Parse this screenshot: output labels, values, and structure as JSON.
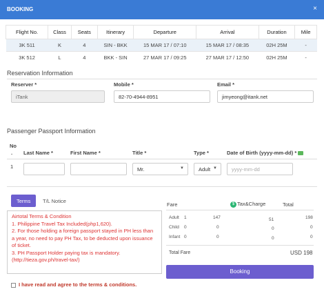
{
  "header": {
    "title": "BOOKING",
    "close_icon": "×"
  },
  "flights": {
    "columns": [
      "Flight No.",
      "Class",
      "Seats",
      "Itinerary",
      "Departure",
      "Arrival",
      "Duration",
      "Mile"
    ],
    "rows": [
      [
        "3K 511",
        "K",
        "4",
        "SIN - BKK",
        "15 MAR 17 / 07:10",
        "15 MAR 17 / 08:35",
        "02H 25M",
        "-"
      ],
      [
        "3K 512",
        "L",
        "4",
        "BKK - SIN",
        "27 MAR 17 / 09:25",
        "27 MAR 17 / 12:50",
        "02H 25M",
        "-"
      ]
    ]
  },
  "reservation": {
    "title": "Reservation Information",
    "reserver_label": "Reserver *",
    "reserver_value": "iTank",
    "mobile_label": "Mobile *",
    "mobile_value": "82-70-4944-8951",
    "email_label": "Email *",
    "email_value": "jimyeong@itank.net"
  },
  "passport": {
    "title": "Passenger Passport Information",
    "no_label_1": "No",
    "no_label_2": ".",
    "last_name_label": "Last Name *",
    "first_name_label": "First Name *",
    "title_label": "Title *",
    "type_label": "Type *",
    "dob_label": "Date of Birth (yyyy-mm-dd) *",
    "row_no": "1",
    "title_value": "Mr.",
    "type_value": "Adult",
    "dob_placeholder": "yyyy-mm-dd"
  },
  "tabs": {
    "terms": "Terms",
    "notice": "T/L Notice"
  },
  "terms": {
    "lines": [
      "Airtotal Terms & Condition",
      "1. Philippine Travel Tax Included(php1,620).",
      "2. For those holding a foreign passport stayed in PH less than",
      "a year, no need to pay PH Tax, to be deducted upon issuance",
      "of ticket.",
      "3. PH Passport Holder paying tax is mandatory.",
      "(http://tieza.gov.ph/travel-tax/)"
    ],
    "agree": "I have read and agree to the terms & conditions."
  },
  "fare": {
    "fare_label": "Fare",
    "tax_label": "Tax&Charge",
    "total_label": "Total",
    "rows": [
      {
        "type": "Adult",
        "count": "1",
        "fare": "147",
        "tax": "51",
        "total": "198"
      },
      {
        "type": "Child",
        "count": "0",
        "fare": "0",
        "tax": "0",
        "total": "0"
      },
      {
        "type": "Infant",
        "count": "0",
        "fare": "0",
        "tax": "0",
        "total": "0"
      }
    ],
    "total_fare_label": "Total Fare",
    "total_fare_value": "USD 198",
    "booking_button": "Booking"
  }
}
